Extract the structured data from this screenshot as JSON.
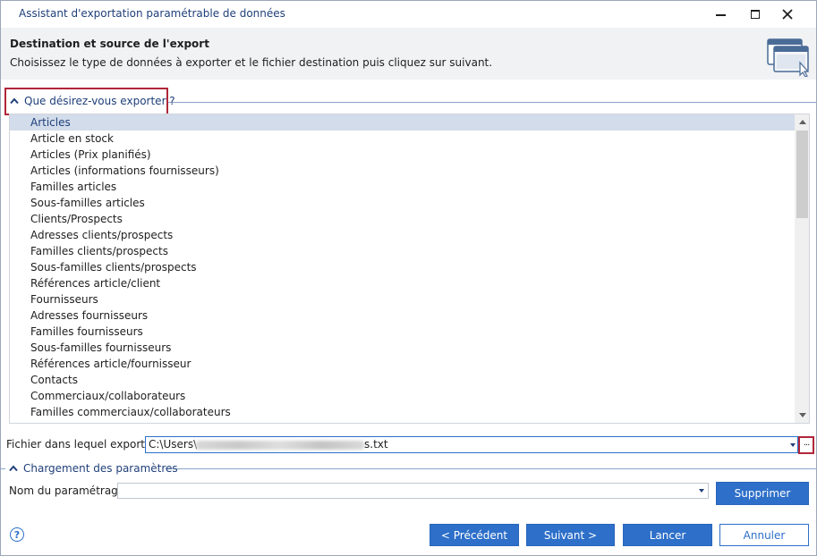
{
  "window": {
    "title": "Assistant d'exportation paramétrable de données"
  },
  "header": {
    "title": "Destination et source de l'export",
    "subtitle": "Choisissez le type de données à exporter et le fichier destination puis cliquez sur suivant."
  },
  "export_section": {
    "label": "Que désirez-vous exporter ?",
    "items": [
      "Articles",
      "Article en stock",
      "Articles (Prix planifiés)",
      "Articles (informations fournisseurs)",
      "Familles articles",
      "Sous-familles articles",
      "Clients/Prospects",
      "Adresses clients/prospects",
      "Familles clients/prospects",
      "Sous-familles clients/prospects",
      "Références article/client",
      "Fournisseurs",
      "Adresses fournisseurs",
      "Familles fournisseurs",
      "Sous-familles fournisseurs",
      "Références article/fournisseur",
      "Contacts",
      "Commerciaux/collaborateurs",
      "Familles commerciaux/collaborateurs"
    ],
    "selected_index": 0
  },
  "file_field": {
    "label": "Fichier dans lequel exporter",
    "value_start": "C:\\Users\\",
    "value_end": "s.txt",
    "browse_label": "···"
  },
  "params_section": {
    "label": "Chargement des paramètres",
    "name_label": "Nom du paramétrage",
    "name_value": "",
    "delete_button": "Supprimer"
  },
  "footer": {
    "help_icon": "?",
    "prev_button": "< Précédent",
    "next_button": "Suivant >",
    "launch_button": "Lancer",
    "cancel_button": "Annuler"
  },
  "colors": {
    "accent": "#2d6fc9",
    "title_text": "#1f3f7a",
    "selection": "#d2dcea",
    "highlight": "#b0273a"
  }
}
